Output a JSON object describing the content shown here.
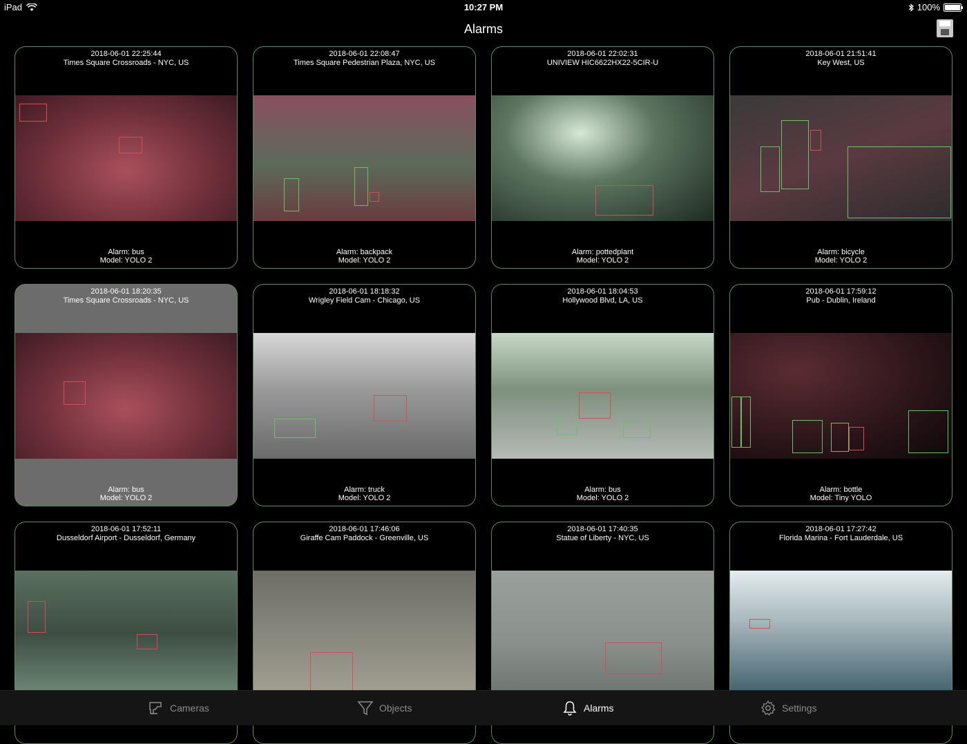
{
  "status_bar": {
    "device": "iPad",
    "time": "10:27 PM",
    "battery": "100%"
  },
  "nav": {
    "title": "Alarms",
    "save_icon": "save-icon"
  },
  "alarms": [
    {
      "datetime": "2018-06-01 22:25:44",
      "camera": "Times Square Crossroads - NYC, US",
      "alarm": "Alarm: bus",
      "model": "Model: YOLO 2",
      "selected": false
    },
    {
      "datetime": "2018-06-01 22:08:47",
      "camera": "Times Square Pedestrian Plaza, NYC, US",
      "alarm": "Alarm: backpack",
      "model": "Model: YOLO 2",
      "selected": false
    },
    {
      "datetime": "2018-06-01 22:02:31",
      "camera": "UNIVIEW HIC6622HX22-5CIR-U",
      "alarm": "Alarm: pottedplant",
      "model": "Model: YOLO 2",
      "selected": false
    },
    {
      "datetime": "2018-06-01 21:51:41",
      "camera": "Key West, US",
      "alarm": "Alarm: bicycle",
      "model": "Model: YOLO 2",
      "selected": false
    },
    {
      "datetime": "2018-06-01 18:20:35",
      "camera": "Times Square Crossroads - NYC, US",
      "alarm": "Alarm: bus",
      "model": "Model: YOLO 2",
      "selected": true
    },
    {
      "datetime": "2018-06-01 18:18:32",
      "camera": "Wrigley Field Cam - Chicago, US",
      "alarm": "Alarm: truck",
      "model": "Model: YOLO 2",
      "selected": false
    },
    {
      "datetime": "2018-06-01 18:04:53",
      "camera": "Hollywood Blvd, LA, US",
      "alarm": "Alarm: bus",
      "model": "Model: YOLO 2",
      "selected": false
    },
    {
      "datetime": "2018-06-01 17:59:12",
      "camera": "Pub - Dublin, Ireland",
      "alarm": "Alarm: bottle",
      "model": "Model: Tiny YOLO",
      "selected": false
    },
    {
      "datetime": "2018-06-01 17:52:11",
      "camera": "Dusseldorf Airport - Dusseldorf, Germany",
      "alarm": "",
      "model": "",
      "selected": false
    },
    {
      "datetime": "2018-06-01 17:46:06",
      "camera": "Giraffe Cam Paddock - Greenville, US",
      "alarm": "",
      "model": "",
      "selected": false
    },
    {
      "datetime": "2018-06-01 17:40:35",
      "camera": "Statue of Liberty - NYC, US",
      "alarm": "",
      "model": "",
      "selected": false
    },
    {
      "datetime": "2018-06-01 17:27:42",
      "camera": "Florida Marina - Fort Lauderdale, US",
      "alarm": "",
      "model": "",
      "selected": false
    }
  ],
  "tabs": [
    {
      "label": "Cameras",
      "icon": "camera-icon",
      "active": false
    },
    {
      "label": "Objects",
      "icon": "filter-icon",
      "active": false
    },
    {
      "label": "Alarms",
      "icon": "bell-icon",
      "active": true
    },
    {
      "label": "Settings",
      "icon": "gear-icon",
      "active": false
    }
  ],
  "colors": {
    "card_border": "#5e8a5e",
    "selected_card": "#6c6c6c",
    "detection_red": "#d0505a",
    "detection_green": "#6cbf6c",
    "tab_inactive": "#8c8c8c",
    "tab_active": "#ffffff"
  }
}
